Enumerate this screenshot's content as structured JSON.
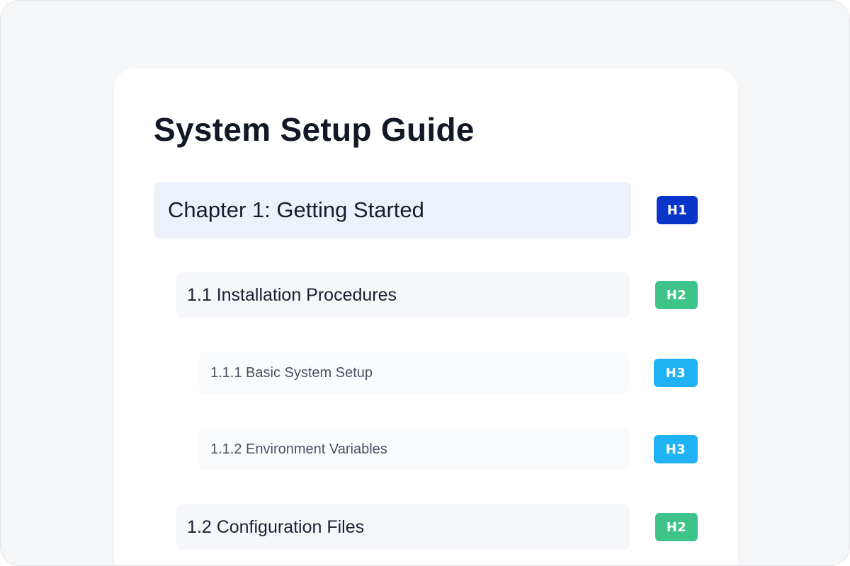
{
  "document": {
    "title": "System Setup Guide"
  },
  "outline": [
    {
      "level": "H1",
      "text": "Chapter 1: Getting Started"
    },
    {
      "level": "H2",
      "text": "1.1 Installation Procedures"
    },
    {
      "level": "H3",
      "text": "1.1.1 Basic System Setup"
    },
    {
      "level": "H3",
      "text": "1.1.2 Environment Variables"
    },
    {
      "level": "H2",
      "text": "1.2 Configuration Files"
    }
  ],
  "colors": {
    "H1": "#0a35c9",
    "H2": "#3ec488",
    "H3": "#20b3f4",
    "h1_row_background": "#ecf1fb"
  }
}
